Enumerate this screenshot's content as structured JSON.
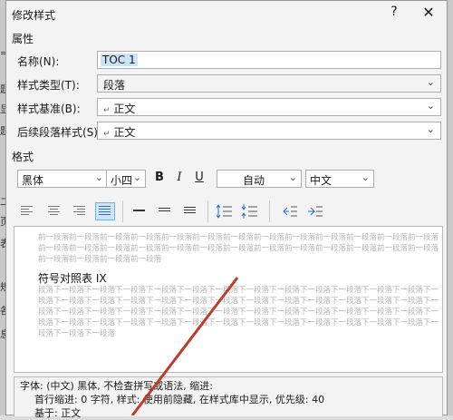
{
  "dialog": {
    "title": "修改样式",
    "help_label": "?",
    "close_label": "✕"
  },
  "properties": {
    "section_label": "属性",
    "name_label": "名称(N):",
    "name_value": "TOC 1",
    "type_label": "样式类型(T):",
    "type_value": "段落",
    "based_label": "样式基准(B):",
    "based_value": "正文",
    "next_label": "后续段落样式(S):",
    "next_value": "正文",
    "para_mark": "↵"
  },
  "format": {
    "section_label": "格式",
    "font": "黑体",
    "size": "小四",
    "bold": "B",
    "italic": "I",
    "underline": "U",
    "color": "自动",
    "script": "中文",
    "dropdown_glyph": "⌄"
  },
  "preview": {
    "prev_line1": "前一段落前一段落前一段落前一段落前一段落前一段落前一段落前一段落前一段落前一段落前一段落前一段落前一段落",
    "prev_line2": "前一段落前一段落前一段落前一段落前一段落前一段落前一段落前一段落前一段落前一段落前一段落前一段落前一段落",
    "prev_line3": "前一段落前一段落前一段落前一段落",
    "sample": "符号对照表 IX",
    "next_line1": "段落下一段落下一段落下一段落下一段落下一段落下一段落下一段落下一段落下一段落下一段落下一段落下一段落下一",
    "next_line2": "段落下一段落下一段落下一段落下一段落下一段落下一段落下一段落下一段落下一段落下一段落下一段落下一段落下一",
    "next_line3": "段落下一段落下一段落下一段落下一段落下一段落下一段落下一段落下一段落下一段落下一段落下一段落下一段落下一",
    "next_line4": "段落下一段落下一段落下一段落下一段落下一段落下一段落下一段落下一段落下一段落下一段落下一段落下一段落下一",
    "next_line5": "段落下一段落下一段落"
  },
  "description": {
    "line1": "字体: (中文) 黑体, 不检查拼写或语法, 缩进:",
    "line2": "首行缩进:  0 字符, 样式: 使用前隐藏, 在样式库中显示, 优先级: 40",
    "line3": "基于: 正文"
  },
  "background_fragments": [
    "=",
    "题",
    "显",
    "题",
    "二",
    "页",
    "表",
    "规",
    "各",
    "息"
  ],
  "colors": {
    "accent": "#0067c0",
    "selection": "#cde3f7",
    "arrow": "#c0392b"
  }
}
